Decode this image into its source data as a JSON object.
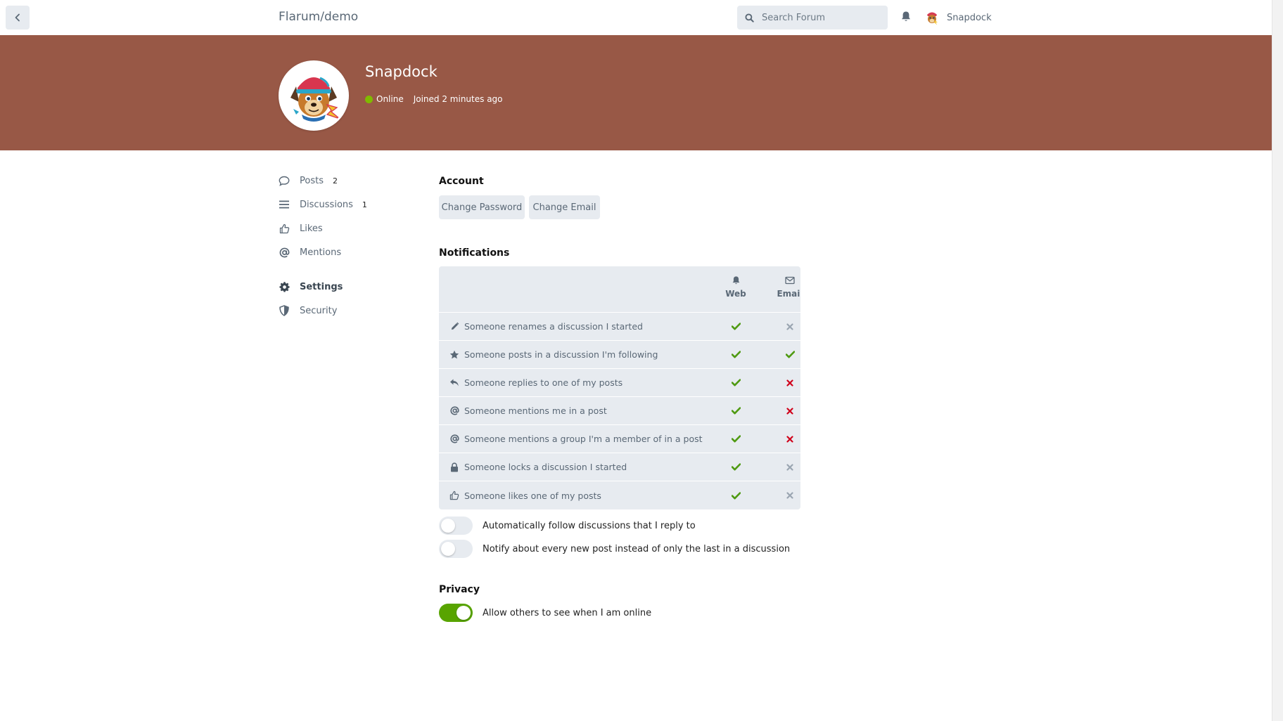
{
  "colors": {
    "hero_bg": "#985846",
    "online": "#7fba00",
    "check_green": "#4f9a12",
    "cross_red": "#d0021b",
    "cross_grey": "#9aa5b1",
    "toggle_on": "#58a400"
  },
  "header": {
    "back_icon": "chevron-left-icon",
    "forum_title": "Flarum/demo",
    "search_placeholder": "Search Forum",
    "search_icon": "search-icon",
    "notifications_icon": "bell-icon",
    "username": "Snapdock"
  },
  "hero": {
    "name": "Snapdock",
    "status": "Online",
    "joined": "Joined 2 minutes ago"
  },
  "nav": {
    "items": [
      {
        "label": "Posts",
        "count": "2",
        "icon": "comment-icon"
      },
      {
        "label": "Discussions",
        "count": "1",
        "icon": "list-icon"
      },
      {
        "label": "Likes",
        "count": "",
        "icon": "thumbs-up-icon"
      },
      {
        "label": "Mentions",
        "count": "",
        "icon": "at-icon"
      },
      {
        "label": "Settings",
        "count": "",
        "icon": "gear-icon"
      },
      {
        "label": "Security",
        "count": "",
        "icon": "shield-icon"
      }
    ],
    "active": "Settings"
  },
  "account": {
    "title": "Account",
    "change_password": "Change Password",
    "change_email": "Change Email"
  },
  "notifications": {
    "title": "Notifications",
    "columns": [
      {
        "label": "Web",
        "icon": "bell-icon"
      },
      {
        "label": "Email",
        "icon": "envelope-icon"
      }
    ],
    "rows": [
      {
        "label": "Someone renames a discussion I started",
        "icon": "pencil-icon",
        "web": "on",
        "email": "off"
      },
      {
        "label": "Someone posts in a discussion I'm following",
        "icon": "star-icon",
        "web": "on",
        "email": "on"
      },
      {
        "label": "Someone replies to one of my posts",
        "icon": "reply-icon",
        "web": "on",
        "email": "disabled"
      },
      {
        "label": "Someone mentions me in a post",
        "icon": "at-icon",
        "web": "on",
        "email": "disabled"
      },
      {
        "label": "Someone mentions a group I'm a member of in a post",
        "icon": "at-icon",
        "web": "on",
        "email": "disabled"
      },
      {
        "label": "Someone locks a discussion I started",
        "icon": "lock-icon",
        "web": "on",
        "email": "off"
      },
      {
        "label": "Someone likes one of my posts",
        "icon": "thumbs-up-icon",
        "web": "on",
        "email": "off"
      }
    ],
    "auto_follow": {
      "label": "Automatically follow discussions that I reply to",
      "on": false
    },
    "notify_every_post": {
      "label": "Notify about every new post instead of only the last in a discussion",
      "on": false
    }
  },
  "privacy": {
    "title": "Privacy",
    "show_online": {
      "label": "Allow others to see when I am online",
      "on": true
    }
  }
}
